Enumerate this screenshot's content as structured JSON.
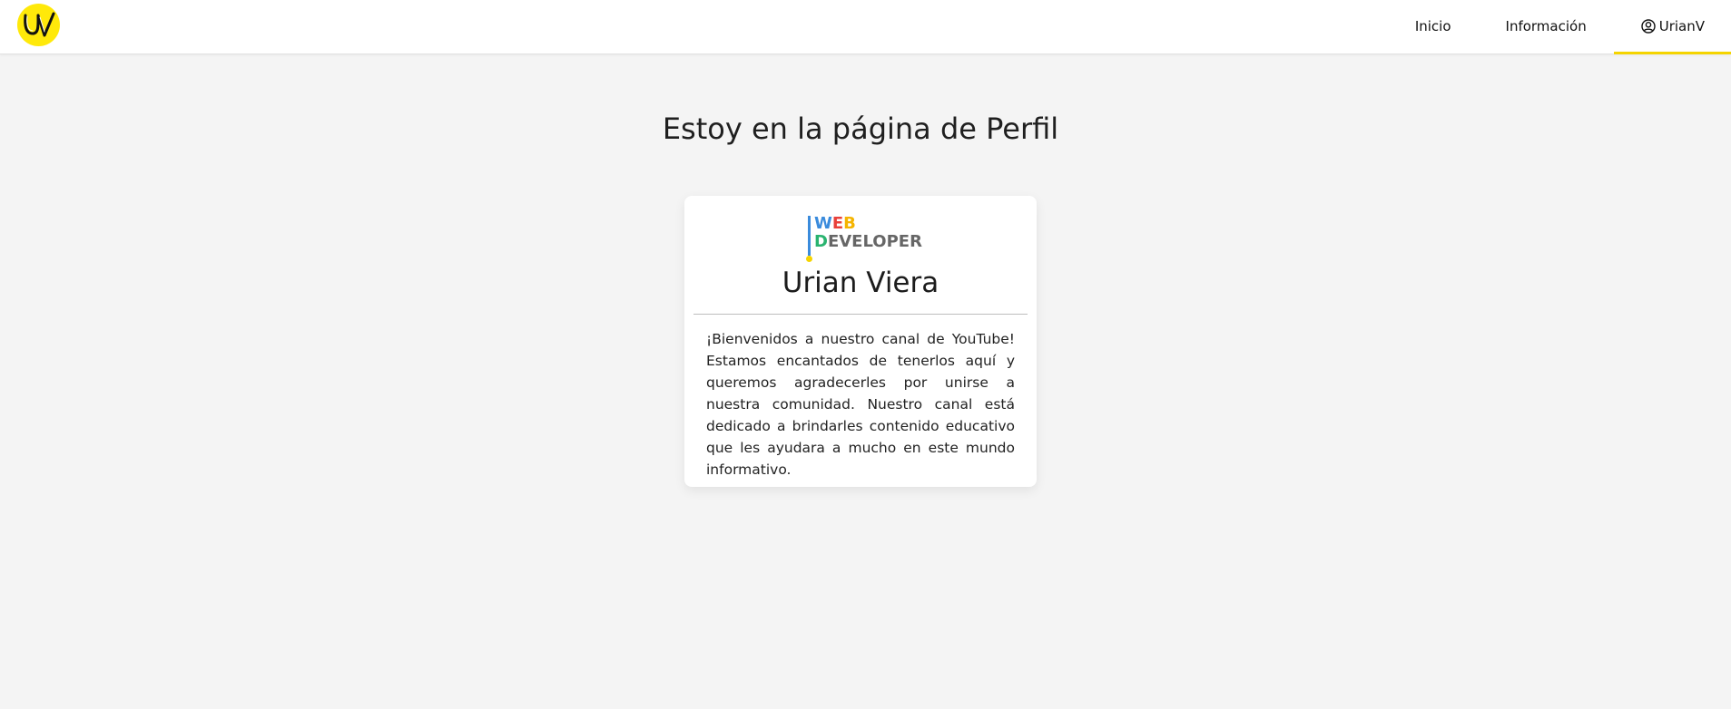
{
  "header": {
    "logo_icon": "uv-logo-icon",
    "logo_color": "#ffe90a",
    "accent_color": "#f5d400",
    "nav": [
      {
        "label": "Inicio"
      },
      {
        "label": "Información"
      },
      {
        "label": "UrianV",
        "icon": "user-circle-icon",
        "active": true
      }
    ]
  },
  "main": {
    "title": "Estoy en la página de Perfil",
    "card": {
      "logo_line1": [
        "W",
        "E",
        "B"
      ],
      "logo_line2": [
        "D",
        "EVELOPER"
      ],
      "logo_colors": [
        "#3a8bdc",
        "#e8403a",
        "#f5b400",
        "#29b36f",
        "#666666"
      ],
      "name": "Urian Viera",
      "description": "¡Bienvenidos a nuestro canal de YouTube! Estamos encantados de tenerlos aquí y queremos agradecerles por unirse a nuestra comunidad. Nuestro canal está dedicado a brindarles contenido educativo que les ayudara a mucho en este mundo informativo."
    }
  }
}
